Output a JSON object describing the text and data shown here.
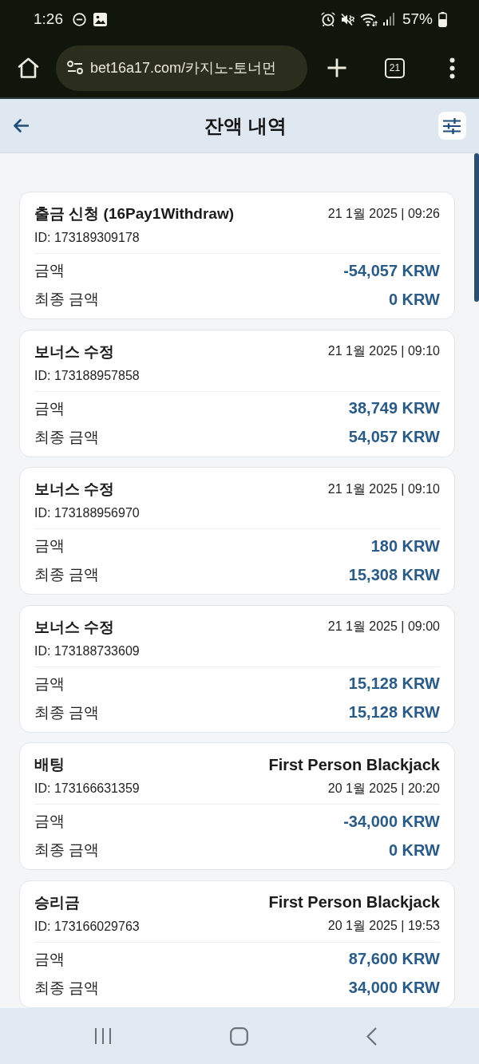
{
  "status_bar": {
    "time": "1:26",
    "battery": "57%"
  },
  "browser": {
    "url": "bet16a17.com/카지노-토너먼",
    "tab_count": "21"
  },
  "header": {
    "title": "잔액 내역"
  },
  "transactions": [
    {
      "title": "출금 신청 (16Pay1Withdraw)",
      "date": "21 1월 2025 | 09:26",
      "id": "ID: 173189309178",
      "rows": [
        {
          "label": "금액",
          "value": "-54,057 KRW"
        },
        {
          "label": "최종 금액",
          "value": "0 KRW"
        }
      ]
    },
    {
      "title": "보너스 수정",
      "date": "21 1월 2025 | 09:10",
      "id": "ID: 173188957858",
      "rows": [
        {
          "label": "금액",
          "value": "38,749 KRW"
        },
        {
          "label": "최종 금액",
          "value": "54,057 KRW"
        }
      ]
    },
    {
      "title": "보너스 수정",
      "date": "21 1월 2025 | 09:10",
      "id": "ID: 173188956970",
      "rows": [
        {
          "label": "금액",
          "value": "180 KRW"
        },
        {
          "label": "최종 금액",
          "value": "15,308 KRW"
        }
      ]
    },
    {
      "title": "보너스 수정",
      "date": "21 1월 2025 | 09:00",
      "id": "ID: 173188733609",
      "rows": [
        {
          "label": "금액",
          "value": "15,128 KRW"
        },
        {
          "label": "최종 금액",
          "value": "15,128 KRW"
        }
      ]
    },
    {
      "title": "배팅",
      "game": "First Person Blackjack",
      "date": "20 1월 2025 | 20:20",
      "id": "ID: 173166631359",
      "rows": [
        {
          "label": "금액",
          "value": "-34,000 KRW"
        },
        {
          "label": "최종 금액",
          "value": "0 KRW"
        }
      ]
    },
    {
      "title": "승리금",
      "game": "First Person Blackjack",
      "date": "20 1월 2025 | 19:53",
      "id": "ID: 173166029763",
      "rows": [
        {
          "label": "금액",
          "value": "87,600 KRW"
        },
        {
          "label": "최종 금액",
          "value": "34,000 KRW"
        }
      ]
    }
  ]
}
